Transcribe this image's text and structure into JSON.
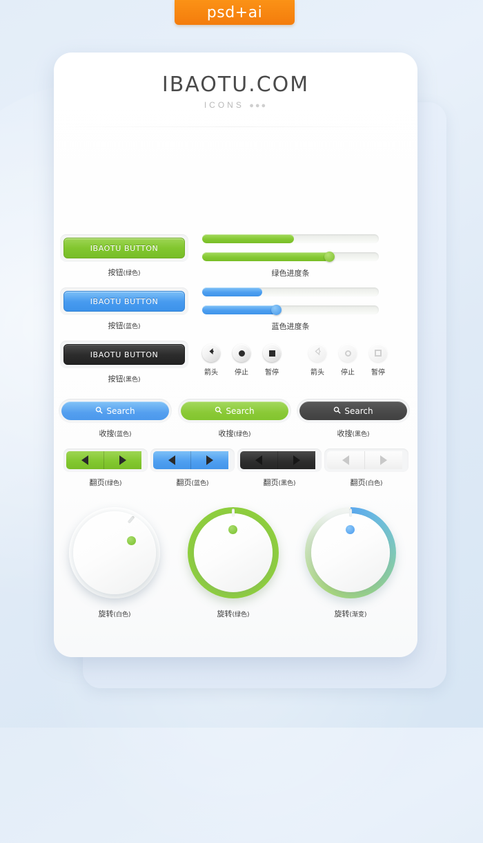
{
  "ribbon": {
    "label": "psd+ai",
    "color": "#f47c0c"
  },
  "header": {
    "title": "IBAOTU.COM",
    "subtitle": "ICONS",
    "dots": "●●●"
  },
  "palette": {
    "green": "#82c72f",
    "blue": "#489bef",
    "black": "#2c2c2c",
    "white": "#f6f7f7",
    "orange": "#f47c0c",
    "background": "#e3edf8"
  },
  "buttons": [
    {
      "name": "button-green",
      "text": "IBAOTU BUTTON",
      "caption_main": "按钮",
      "caption_sub": "(绿色)",
      "style": "green"
    },
    {
      "name": "button-blue",
      "text": "IBAOTU BUTTON",
      "caption_main": "按钮",
      "caption_sub": "(蓝色)",
      "style": "blue"
    },
    {
      "name": "button-black",
      "text": "IBAOTU BUTTON",
      "caption_main": "按钮",
      "caption_sub": "(黑色)",
      "style": "black"
    }
  ],
  "progress": [
    {
      "name": "progress-green",
      "caption": "绿色进度条",
      "style": "green",
      "bar_percent": 52,
      "slider_percent": 72
    },
    {
      "name": "progress-blue",
      "caption": "蓝色进度条",
      "style": "blue",
      "bar_percent": 34,
      "slider_percent": 42
    }
  ],
  "media_buttons": {
    "dark": [
      {
        "name": "arrow",
        "icon": "arrow-left-icon",
        "caption": "箭头"
      },
      {
        "name": "stop",
        "icon": "record-circle-icon",
        "caption": "停止"
      },
      {
        "name": "pause",
        "icon": "stop-square-icon",
        "caption": "暂停"
      }
    ],
    "light": [
      {
        "name": "arrow",
        "icon": "arrow-left-icon",
        "caption": "箭头"
      },
      {
        "name": "stop",
        "icon": "record-circle-icon",
        "caption": "停止"
      },
      {
        "name": "pause",
        "icon": "stop-square-icon",
        "caption": "暂停"
      }
    ]
  },
  "search_buttons": [
    {
      "name": "search-blue",
      "text": "Search",
      "icon": "search-icon",
      "caption_main": "收搜",
      "caption_sub": "(蓝色)",
      "style": "blue"
    },
    {
      "name": "search-green",
      "text": "Search",
      "icon": "search-icon",
      "caption_main": "收搜",
      "caption_sub": "(绿色)",
      "style": "green"
    },
    {
      "name": "search-black",
      "text": "Search",
      "icon": "search-icon",
      "caption_main": "收搜",
      "caption_sub": "(黑色)",
      "style": "black"
    }
  ],
  "pagers": [
    {
      "name": "pager-green",
      "caption_main": "翻页",
      "caption_sub": "(绿色)",
      "style": "green",
      "prev_icon": "triangle-left-icon",
      "next_icon": "triangle-right-icon"
    },
    {
      "name": "pager-blue",
      "caption_main": "翻页",
      "caption_sub": "(蓝色)",
      "style": "blue",
      "prev_icon": "triangle-left-icon",
      "next_icon": "triangle-right-icon"
    },
    {
      "name": "pager-black",
      "caption_main": "翻页",
      "caption_sub": "(黑色)",
      "style": "black",
      "prev_icon": "triangle-left-icon",
      "next_icon": "triangle-right-icon"
    },
    {
      "name": "pager-white",
      "caption_main": "翻页",
      "caption_sub": "(白色)",
      "style": "white",
      "prev_icon": "triangle-left-icon",
      "next_icon": "triangle-right-icon"
    }
  ],
  "knobs": [
    {
      "name": "knob-white",
      "caption_main": "旋转",
      "caption_sub": "(白色)",
      "style": "white",
      "indicator_color": "#79c02c",
      "indicator_angle": 52
    },
    {
      "name": "knob-green",
      "caption_main": "旋转",
      "caption_sub": "(绿色)",
      "style": "green",
      "indicator_color": "#79c02c",
      "indicator_angle": 0
    },
    {
      "name": "knob-gradient",
      "caption_main": "旋转",
      "caption_sub": "(渐变)",
      "style": "gradient",
      "indicator_color": "#4a9bee",
      "indicator_angle": 0
    }
  ]
}
